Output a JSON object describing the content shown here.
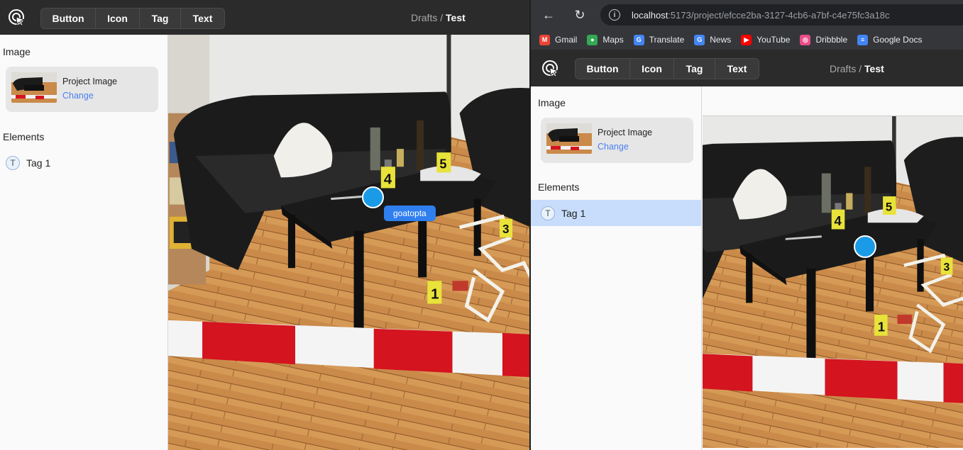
{
  "app": {
    "toolbar": [
      "Button",
      "Icon",
      "Tag",
      "Text"
    ],
    "breadcrumb_parent": "Drafts",
    "breadcrumb_sep": " / ",
    "breadcrumb_current": "Test"
  },
  "sidebar": {
    "image_section": "Image",
    "image_name": "Project Image",
    "image_change": "Change",
    "elements_section": "Elements",
    "elements": [
      {
        "badge": "T",
        "label": "Tag 1"
      }
    ]
  },
  "canvas": {
    "tag_tooltip": "goatopta",
    "evidence_markers": [
      "1",
      "3",
      "4",
      "5"
    ]
  },
  "browser": {
    "url_host": "localhost",
    "url_path": ":5173/project/efcce2ba-3127-4cb6-a7bf-c4e75fc3a18c",
    "bookmarks": [
      {
        "label": "Gmail",
        "icon": "gmail-icon",
        "color": "#ea4335",
        "glyph": "M"
      },
      {
        "label": "Maps",
        "icon": "maps-icon",
        "color": "#34a853",
        "glyph": "●"
      },
      {
        "label": "Translate",
        "icon": "translate-icon",
        "color": "#4285f4",
        "glyph": "G"
      },
      {
        "label": "News",
        "icon": "news-icon",
        "color": "#4285f4",
        "glyph": "G"
      },
      {
        "label": "YouTube",
        "icon": "youtube-icon",
        "color": "#ff0000",
        "glyph": "▶"
      },
      {
        "label": "Dribbble",
        "icon": "dribbble-icon",
        "color": "#ea4c89",
        "glyph": "◎"
      },
      {
        "label": "Google Docs",
        "icon": "docs-icon",
        "color": "#4285f4",
        "glyph": "≡"
      }
    ]
  },
  "colors": {
    "accent": "#2f7fef",
    "marker": "#1a9be8",
    "selection": "#c7ddfb",
    "appbar": "#2b2b2b"
  }
}
